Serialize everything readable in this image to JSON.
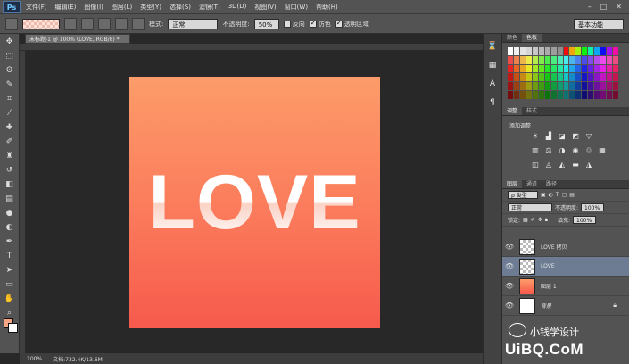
{
  "app": {
    "logo": "Ps"
  },
  "menu": [
    "文件(F)",
    "编辑(E)",
    "图像(I)",
    "图层(L)",
    "类型(Y)",
    "选择(S)",
    "滤镜(T)",
    "3D(D)",
    "视图(V)",
    "窗口(W)",
    "帮助(H)"
  ],
  "window_controls": [
    "–",
    "□",
    "✕"
  ],
  "options": {
    "mode_label": "模式:",
    "mode_value": "正常",
    "opacity_label": "不透明度:",
    "opacity_value": "50%",
    "reverse_label": "反向",
    "dither_label": "仿色",
    "transparency_label": "透明区域",
    "workspace": "基本功能"
  },
  "document": {
    "tab_title": "未标题-1 @ 100% (LOVE, RGB/8) *",
    "canvas_text": "LOVE",
    "zoom": "100%",
    "doc_size": "文档:732.4K/13.6M"
  },
  "panels": {
    "color_tabs": [
      "颜色",
      "色板"
    ],
    "adjust_tabs": [
      "调整",
      "样式"
    ],
    "adjust_title": "添加调整",
    "layers_tabs": [
      "图层",
      "通道",
      "路径"
    ],
    "filter_kind": "ρ 类型",
    "blend_mode": "正常",
    "opacity_label": "不透明度:",
    "opacity_value": "100%",
    "lock_label": "锁定:",
    "fill_label": "填充:",
    "fill_value": "100%",
    "layers": [
      {
        "name": "LOVE 拷贝",
        "thumb": "transparent",
        "selected": false
      },
      {
        "name": "LOVE",
        "thumb": "transparent",
        "selected": true
      },
      {
        "name": "图层 1",
        "thumb": "gradient",
        "selected": false
      },
      {
        "name": "背景",
        "thumb": "white",
        "selected": false,
        "locked": true
      }
    ]
  },
  "watermark": {
    "text": "小钱学设计",
    "site": "UiBQ.CoM"
  },
  "colors": {
    "foreground": "#f6a483",
    "background": "#ffffff",
    "gradient_top": "#fd9c6a",
    "gradient_bottom": "#f65a4c",
    "layer_selected": "#6d7c93"
  }
}
